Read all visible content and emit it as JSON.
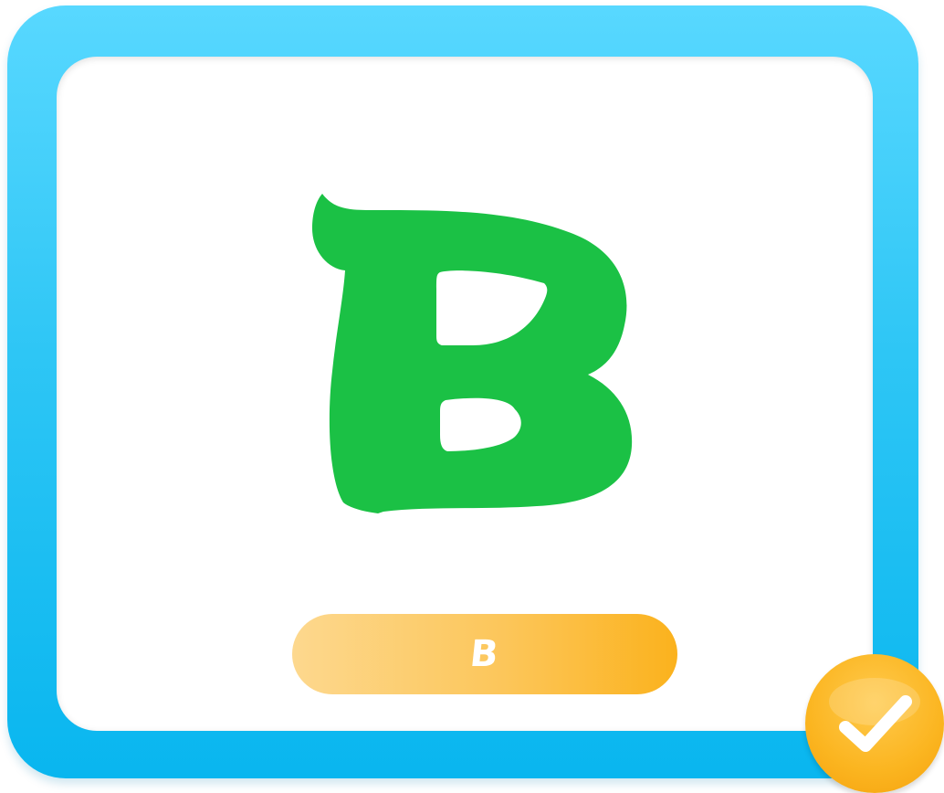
{
  "card": {
    "frame_color": "#2ec6f5",
    "letter_color": "#1bc145"
  },
  "big_letter": "B",
  "label_button": {
    "text": "B",
    "color": "#fbb21d"
  },
  "check_badge": {
    "icon": "check-icon",
    "color": "#fbb520"
  }
}
